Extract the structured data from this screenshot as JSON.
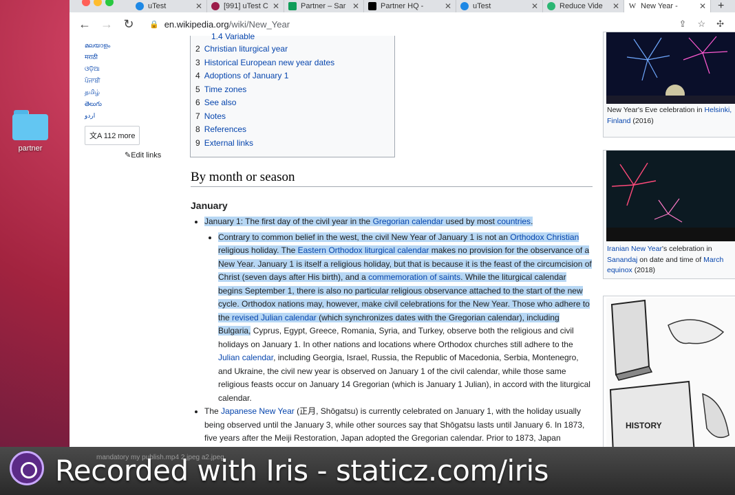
{
  "desktop": {
    "folder_label": "partner"
  },
  "tabs": [
    {
      "label": "uTest",
      "favicon_color": "#1e88e5"
    },
    {
      "label": "[991] uTest C",
      "favicon_color": "#9c1c4a"
    },
    {
      "label": "Partner – Sar",
      "favicon_color": "#0f9d58"
    },
    {
      "label": "Partner HQ -",
      "favicon_color": "#000000"
    },
    {
      "label": "uTest",
      "favicon_color": "#1e88e5"
    },
    {
      "label": "Reduce Vide",
      "favicon_color": "#2bb673"
    },
    {
      "label": "New Year - ",
      "favicon_color": "#ffffff"
    }
  ],
  "address": {
    "domain": "en.wikipedia.org",
    "path": "/wiki/New_Year"
  },
  "sidebar": {
    "languages": [
      "മലയാളം",
      "मराठी",
      "ଓଡ଼ିଆ",
      "ਪੰਜਾਬੀ",
      "தமிழ்",
      "తెలుగు",
      "اردو"
    ],
    "more_label": "112 more",
    "edit_links": "Edit links"
  },
  "toc": {
    "cut_item": "1.4  Variable",
    "items": [
      {
        "num": "2",
        "text": "Christian liturgical year"
      },
      {
        "num": "3",
        "text": "Historical European new year dates"
      },
      {
        "num": "4",
        "text": "Adoptions of January 1"
      },
      {
        "num": "5",
        "text": "Time zones"
      },
      {
        "num": "6",
        "text": "See also"
      },
      {
        "num": "7",
        "text": "Notes"
      },
      {
        "num": "8",
        "text": "References"
      },
      {
        "num": "9",
        "text": "External links"
      }
    ]
  },
  "article": {
    "heading": "By month or season",
    "subheading": "January",
    "b1_pre": "January 1: The first day of the civil year in the ",
    "b1_link1": "Gregorian calendar",
    "b1_mid": " used by most ",
    "b1_link2": "countries",
    "b1_end": ".",
    "p1": "Contrary to common belief in the west, the civil New Year of January 1 is not an ",
    "p1_link": "Orthodox Christian",
    "p2": " religious holiday. The ",
    "p2_link": "Eastern Orthodox liturgical calendar",
    "p3": " makes no provision for the observance of a New Year. January 1 is itself a religious holiday, but that is because it is the feast of the circumcision of Christ (seven days after His birth), and a ",
    "p3_link": "commemoration of saints",
    "p4": ". While the liturgical calendar begins September 1, there is also no particular religious observance attached to the start of the new cycle. Orthodox nations may, however, make civil celebrations for the New Year. Those who adhere to the ",
    "p4_link": "revised Julian calendar",
    "p5": " (which synchronizes dates with the Gregorian calendar), including Bulgaria,",
    "p6": " Cyprus, Egypt, Greece, Romania, Syria, and Turkey, observe both the religious and civil holidays on January 1. In other nations and locations where Orthodox churches still adhere to the ",
    "p6_link": "Julian calendar",
    "p7": ", including Georgia, Israel, Russia, the Republic of Macedonia, Serbia, Montenegro, and Ukraine, the civil new year is observed on January 1 of the civil calendar, while those same religious feasts occur on January 14 Gregorian (which is January 1 Julian), in accord with the liturgical calendar.",
    "b2_pre": "The ",
    "b2_link": "Japanese New Year",
    "b2_text": " (正月, Shōgatsu) is currently celebrated on January 1, with the holiday usually being observed until the January 3, while other sources say that Shōgatsu lasts until January 6. In 1873, five years after the Meiji Restoration, Japan adopted the Gregorian calendar. Prior to 1873, Japan"
  },
  "figures": {
    "cap1_pre": "New Year's Eve celebration in ",
    "cap1_link": "Helsinki, Finland",
    "cap1_post": " (2016)",
    "cap2_link1": "Iranian New Year",
    "cap2_mid": "'s celebration in ",
    "cap2_link2": "Sanandaj",
    "cap2_mid2": " on date and time of ",
    "cap2_link3": "March equinox",
    "cap2_post": " (2018)",
    "cartoon_text": "HISTORY"
  },
  "dock": {
    "faint_items": "mandatory my           publish.mp4           2.jpeg           a2.jpeg"
  },
  "watermark": "Recorded with Iris - staticz.com/iris"
}
